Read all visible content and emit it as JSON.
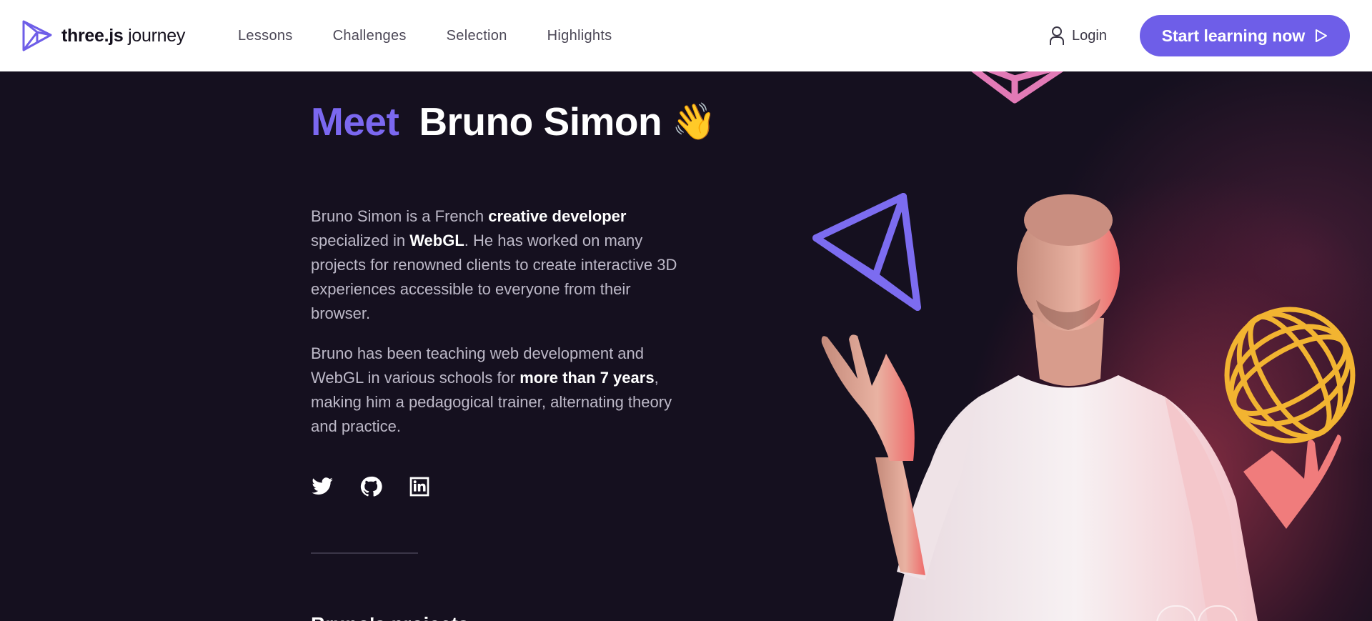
{
  "header": {
    "logo": {
      "bold": "three.js",
      "light": " journey"
    },
    "nav": [
      "Lessons",
      "Challenges",
      "Selection",
      "Highlights"
    ],
    "login_label": "Login",
    "cta_label": "Start learning now"
  },
  "hero": {
    "title_accent": "Meet",
    "title_name": "Bruno Simon",
    "title_emoji": "👋",
    "bio": {
      "p1": [
        "Bruno Simon is a French ",
        "creative developer",
        " specialized in ",
        "WebGL",
        ". He has worked on many projects for renowned clients to create interactive 3D experiences accessible to everyone from their browser."
      ],
      "p2": [
        "Bruno has been teaching web development and WebGL in various schools for ",
        "more than 7 years",
        ", making him a pedagogical trainer, alternating theory and practice."
      ]
    },
    "socials": [
      "twitter-icon",
      "github-icon",
      "linkedin-icon"
    ],
    "next_heading": "Bruno's projects"
  },
  "colors": {
    "accent": "#6e5ee8",
    "accent_text": "#7b68f0",
    "background": "#15101f",
    "header_bg": "#ffffff"
  }
}
